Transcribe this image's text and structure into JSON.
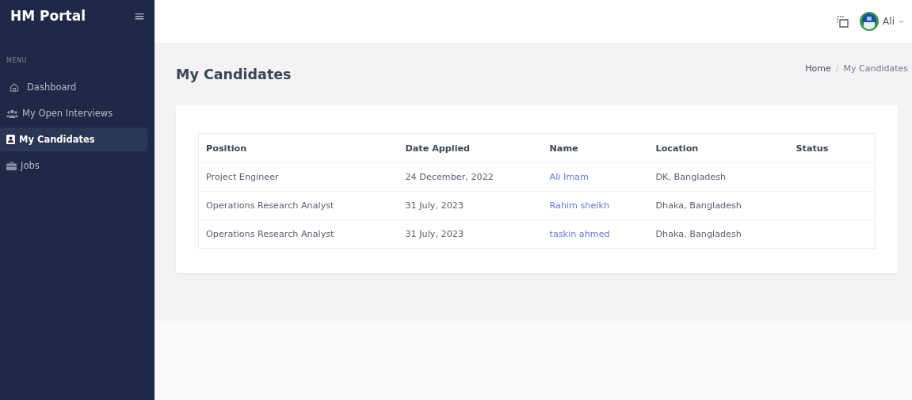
{
  "sidebar": {
    "brand": "HM Portal",
    "menu_button": "≡",
    "section_label": "MENU",
    "items": [
      {
        "label": "Dashboard",
        "selected": false
      },
      {
        "label": "My Open Interviews",
        "selected": false
      },
      {
        "label": "My Candidates",
        "selected": true
      },
      {
        "label": "Jobs",
        "selected": false
      }
    ]
  },
  "header": {
    "user": "Ali"
  },
  "page": {
    "title": "My Candidates",
    "breadcrumb_separator": "/",
    "breadcrumb": [
      {
        "label": "Home",
        "current": false
      },
      {
        "label": "My Candidates",
        "current": true
      }
    ]
  },
  "table": {
    "columns": [
      "Position",
      "Date Applied",
      "Name",
      "Location",
      "Status"
    ],
    "rows": [
      [
        "Project Engineer",
        "24 December, 2022",
        "Ali Imam",
        "DK, Bangladesh"
      ],
      [
        "Operations Research Analyst",
        "31 July, 2023",
        "Rahim sheikh",
        "Dhaka, Bangladesh"
      ],
      [
        "Operations Research Analyst",
        "31 July, 2023",
        "taskin ahmed",
        "Dhaka, Bangladesh"
      ]
    ]
  }
}
